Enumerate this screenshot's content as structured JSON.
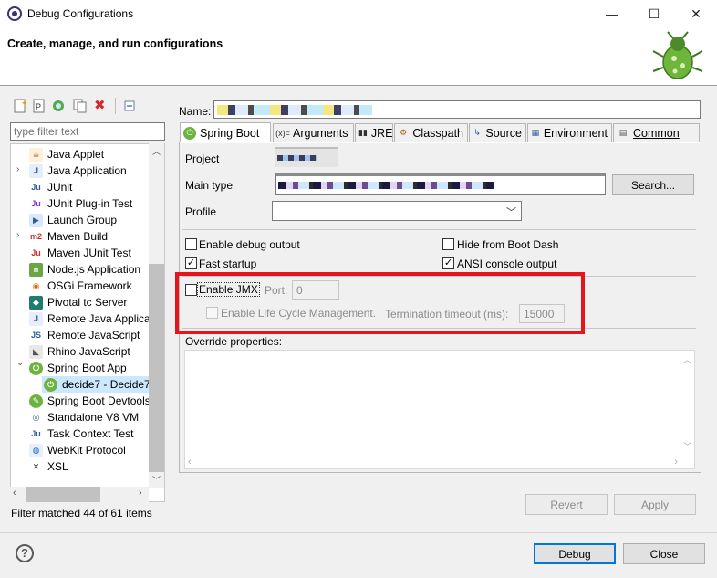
{
  "window": {
    "title": "Debug Configurations"
  },
  "header": {
    "heading": "Create, manage, and run configurations"
  },
  "left": {
    "filter_placeholder": "type filter text",
    "tree": [
      {
        "label": "Java Applet",
        "icon": "java-applet-icon"
      },
      {
        "label": "Java Application",
        "icon": "java-application-icon"
      },
      {
        "label": "JUnit",
        "icon": "junit-icon"
      },
      {
        "label": "JUnit Plug-in Test",
        "icon": "junit-plugin-icon"
      },
      {
        "label": "Launch Group",
        "icon": "launch-group-icon"
      },
      {
        "label": "Maven Build",
        "icon": "maven-icon"
      },
      {
        "label": "Maven JUnit Test",
        "icon": "maven-junit-icon"
      },
      {
        "label": "Node.js Application",
        "icon": "nodejs-icon"
      },
      {
        "label": "OSGi Framework",
        "icon": "osgi-icon"
      },
      {
        "label": "Pivotal tc Server",
        "icon": "pivotal-icon"
      },
      {
        "label": "Remote Java Applicati",
        "icon": "remote-java-icon"
      },
      {
        "label": "Remote JavaScript",
        "icon": "remote-javascript-icon"
      },
      {
        "label": "Rhino JavaScript",
        "icon": "rhino-icon"
      },
      {
        "label": "Spring Boot App",
        "icon": "spring-boot-icon"
      },
      {
        "label": "decide7 - Decide7",
        "icon": "spring-boot-icon"
      },
      {
        "label": "Spring Boot Devtools",
        "icon": "spring-devtools-icon"
      },
      {
        "label": "Standalone V8 VM",
        "icon": "v8-icon"
      },
      {
        "label": "Task Context Test",
        "icon": "task-context-icon"
      },
      {
        "label": "WebKit Protocol",
        "icon": "webkit-icon"
      },
      {
        "label": "XSL",
        "icon": "xsl-icon"
      }
    ],
    "filter_status": "Filter matched 44 of 61 items"
  },
  "right": {
    "name_label": "Name:",
    "tabs": [
      "Spring Boot",
      "Arguments",
      "JRE",
      "Classpath",
      "Source",
      "Environment",
      "Common"
    ],
    "project_label": "Project",
    "main_type_label": "Main type",
    "search_button": "Search...",
    "profile_label": "Profile",
    "enable_debug_output": "Enable debug output",
    "hide_from_boot_dash": "Hide from Boot Dash",
    "fast_startup": "Fast startup",
    "ansi_console_output": "ANSI console output",
    "enable_jmx": "Enable JMX",
    "port_label": "Port:",
    "port_value": "0",
    "enable_lifecycle": "Enable Life Cycle Management.",
    "termination_timeout_label": "Termination timeout (ms):",
    "termination_timeout_value": "15000",
    "override_properties_label": "Override properties:",
    "revert_button": "Revert",
    "apply_button": "Apply"
  },
  "footer": {
    "debug_button": "Debug",
    "close_button": "Close"
  },
  "colors": {
    "highlight": "#e8141c",
    "spring_green": "#6db33f"
  }
}
